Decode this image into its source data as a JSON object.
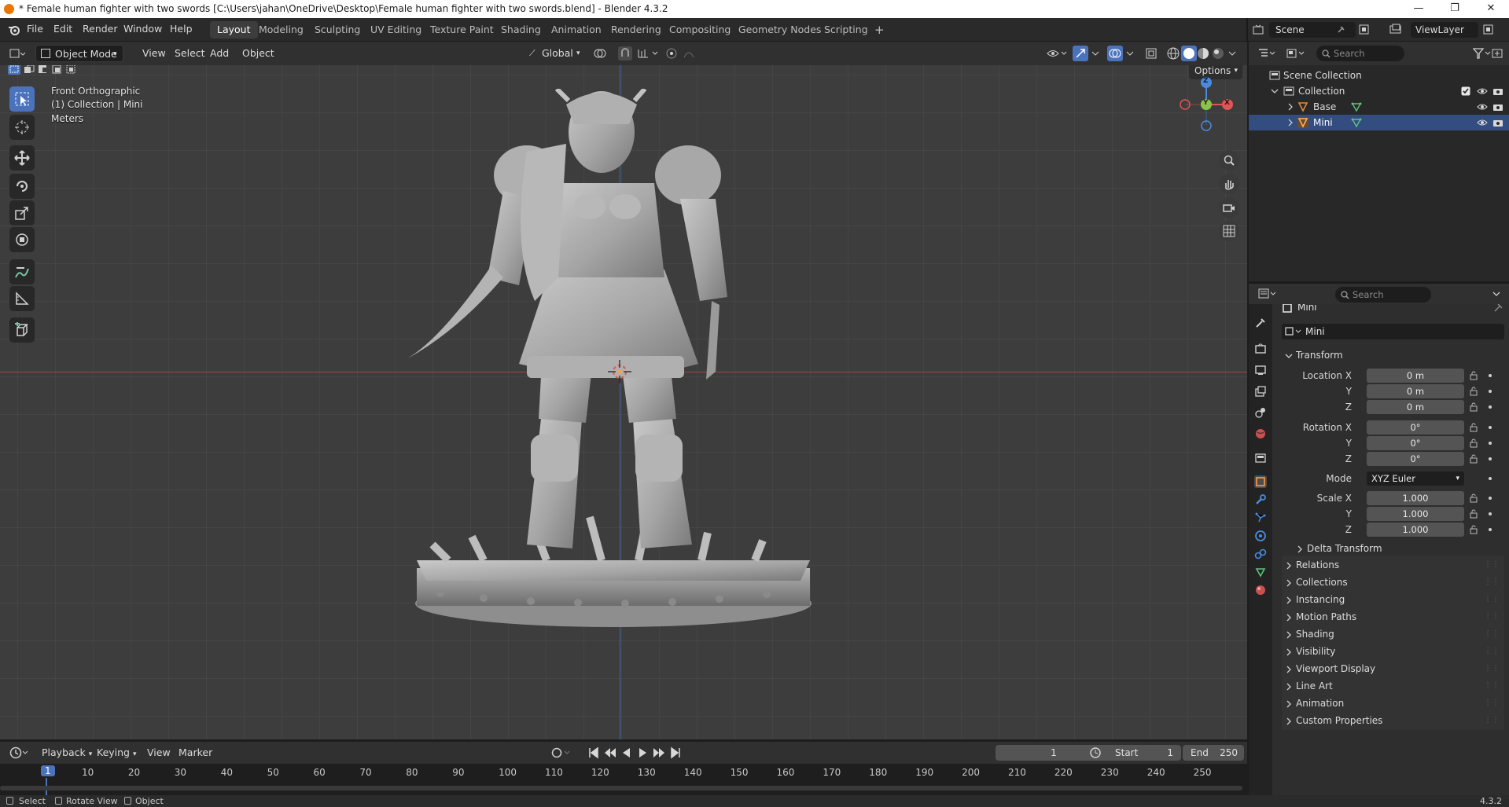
{
  "window": {
    "title": "* Female human fighter with two swords [C:\\Users\\jahan\\OneDrive\\Desktop\\Female human fighter with two swords.blend] - Blender 4.3.2",
    "minimize": "—",
    "maximize": "❐",
    "close": "✕"
  },
  "menu": [
    "File",
    "Edit",
    "Render",
    "Window",
    "Help"
  ],
  "workspaces": [
    "Layout",
    "Modeling",
    "Sculpting",
    "UV Editing",
    "Texture Paint",
    "Shading",
    "Animation",
    "Rendering",
    "Compositing",
    "Geometry Nodes",
    "Scripting"
  ],
  "workspace_add": "+",
  "scene": {
    "label": "Scene",
    "view_layer": "ViewLayer"
  },
  "viewport_header": {
    "mode": "Object Mode",
    "menus": [
      "View",
      "Select",
      "Add",
      "Object"
    ],
    "orientation": "Global",
    "options": "Options"
  },
  "viewport": {
    "info": [
      "Front Orthographic",
      "(1) Collection | Mini",
      "Meters"
    ],
    "gizmo": {
      "z": "Z",
      "y": "Y",
      "x": "X"
    }
  },
  "timeline": {
    "menus": [
      "Playback",
      "Keying",
      "View",
      "Marker"
    ],
    "current_frame": "1",
    "start_label": "Start",
    "start": "1",
    "end_label": "End",
    "end": "250",
    "ruler": [
      "1",
      "10",
      "20",
      "30",
      "40",
      "50",
      "60",
      "70",
      "80",
      "90",
      "100",
      "110",
      "120",
      "130",
      "140",
      "150",
      "160",
      "170",
      "180",
      "190",
      "200",
      "210",
      "220",
      "230",
      "240",
      "250"
    ]
  },
  "status_bar": {
    "items": [
      "Select",
      "Rotate View",
      "Object"
    ],
    "version": "4.3.2"
  },
  "outliner": {
    "search_placeholder": "Search",
    "scene_collection": "Scene Collection",
    "collection": "Collection",
    "objects": [
      "Base",
      "Mini"
    ]
  },
  "properties": {
    "search_placeholder": "Search",
    "object_name": "Mini",
    "data_name": "Mini",
    "transform": {
      "title": "Transform",
      "location_label": "Location X",
      "location": [
        "0 m",
        "0 m",
        "0 m"
      ],
      "rotation_label": "Rotation X",
      "rotation": [
        "0°",
        "0°",
        "0°"
      ],
      "mode_label": "Mode",
      "mode": "XYZ Euler",
      "scale_label": "Scale X",
      "scale": [
        "1.000",
        "1.000",
        "1.000"
      ],
      "y_label": "Y",
      "z_label": "Z"
    },
    "delta_transform": "Delta Transform",
    "panels": [
      "Relations",
      "Collections",
      "Instancing",
      "Motion Paths",
      "Shading",
      "Visibility",
      "Viewport Display",
      "Line Art",
      "Animation",
      "Custom Properties"
    ]
  },
  "colors": {
    "active_tool": "#4b73bc",
    "x_axis": "#e05555",
    "y_axis": "#8bc34a",
    "z_axis": "#4a8be0",
    "object_icon": "#e08a3c"
  }
}
